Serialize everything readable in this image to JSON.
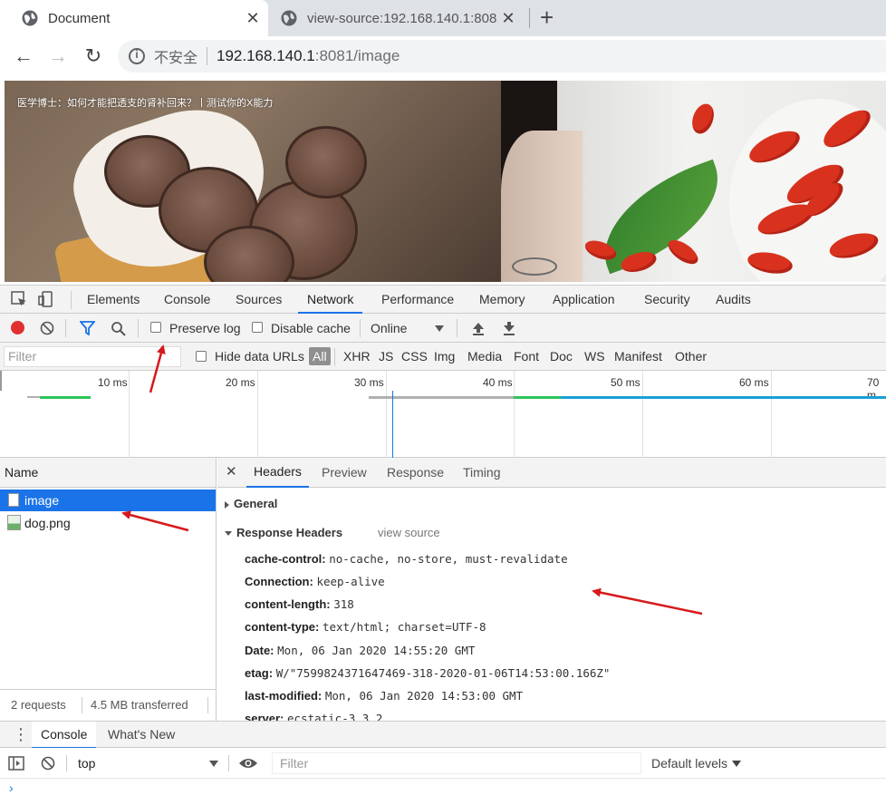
{
  "browser": {
    "tabs": [
      {
        "title": "Document",
        "active": true
      },
      {
        "title": "view-source:192.168.140.1:808",
        "active": false
      }
    ],
    "insecure_label": "不安全",
    "url_host": "192.168.140.1",
    "url_rest": ":8081/image"
  },
  "page": {
    "banner_caption": "医学博士：如何才能把透支的肾补回来？丨测试你的X能力"
  },
  "devtools": {
    "panels": [
      "Elements",
      "Console",
      "Sources",
      "Network",
      "Performance",
      "Memory",
      "Application",
      "Security",
      "Audits"
    ],
    "active_panel": "Network",
    "network_toolbar": {
      "preserve_log": "Preserve log",
      "disable_cache": "Disable cache",
      "throttling": "Online"
    },
    "filter": {
      "placeholder": "Filter",
      "hide_data_urls": "Hide data URLs",
      "types": [
        "All",
        "XHR",
        "JS",
        "CSS",
        "Img",
        "Media",
        "Font",
        "Doc",
        "WS",
        "Manifest",
        "Other"
      ]
    },
    "timeline_ticks": [
      "10 ms",
      "20 ms",
      "30 ms",
      "40 ms",
      "50 ms",
      "60 ms",
      "70 m"
    ],
    "requests_header": "Name",
    "requests": [
      {
        "name": "image",
        "selected": true
      },
      {
        "name": "dog.png",
        "selected": false
      }
    ],
    "summary": {
      "requests": "2 requests",
      "transferred": "4.5 MB transferred"
    },
    "detail_tabs": [
      "Headers",
      "Preview",
      "Response",
      "Timing"
    ],
    "active_detail_tab": "Headers",
    "general_label": "General",
    "response_headers_label": "Response Headers",
    "view_source_label": "view source",
    "response_headers": [
      {
        "key": "cache-control:",
        "value": "no-cache, no-store, must-revalidate"
      },
      {
        "key": "Connection:",
        "value": "keep-alive"
      },
      {
        "key": "content-length:",
        "value": "318"
      },
      {
        "key": "content-type:",
        "value": "text/html; charset=UTF-8"
      },
      {
        "key": "Date:",
        "value": "Mon, 06 Jan 2020 14:55:20 GMT"
      },
      {
        "key": "etag:",
        "value": "W/\"7599824371647469-318-2020-01-06T14:53:00.166Z\""
      },
      {
        "key": "last-modified:",
        "value": "Mon, 06 Jan 2020 14:53:00 GMT"
      },
      {
        "key": "server:",
        "value": "ecstatic-3.3.2"
      }
    ],
    "drawer_tabs": [
      "Console",
      "What's New"
    ],
    "console": {
      "context": "top",
      "filter_placeholder": "Filter",
      "levels": "Default levels"
    }
  },
  "colors": {
    "accent": "#1a73e8",
    "record": "#e0302f",
    "annotation": "#d7191c"
  }
}
